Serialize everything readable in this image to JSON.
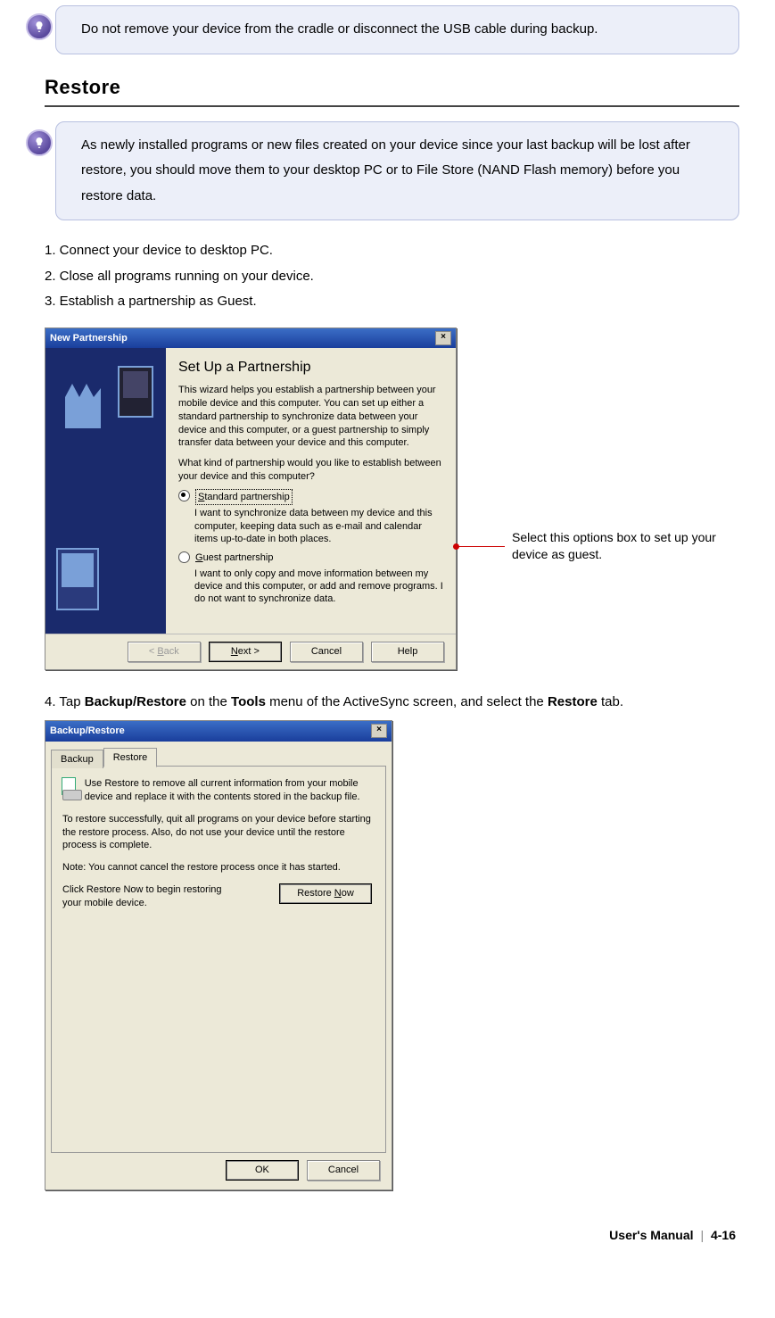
{
  "note1": {
    "text": "Do not remove your device from the cradle or disconnect the USB cable during backup."
  },
  "section_heading": "Restore",
  "note2": {
    "text": "As newly installed programs or new files created on your device since your last backup will be lost after restore, you should move them to your desktop PC or to File Store (NAND Flash memory) before you restore data."
  },
  "steps": {
    "s1": "1. Connect your device to desktop PC.",
    "s2": "2. Close all programs running on your device.",
    "s3": "3. Establish a partnership as Guest."
  },
  "callout": "Select this options box to set up your device as guest.",
  "dlg1": {
    "title": "New Partnership",
    "heading": "Set Up a Partnership",
    "intro": "This wizard helps you establish a partnership between your mobile device and this computer. You can set up either a standard partnership to synchronize data between your device and this computer, or a guest partnership to simply transfer data between your device and this computer.",
    "question": "What kind of partnership would you like to establish between your device and this computer?",
    "opt1_pre": "S",
    "opt1_rest": "tandard partnership",
    "opt1_desc": "I want to synchronize data between my device and this computer, keeping data such as e-mail and calendar items up-to-date in both places.",
    "opt2_pre": "G",
    "opt2_rest": "uest partnership",
    "opt2_desc": "I want to only copy and move information between my device and this computer, or add and remove programs. I do not want to synchronize data.",
    "btn_back_pre": "< ",
    "btn_back_u": "B",
    "btn_back_rest": "ack",
    "btn_next_u": "N",
    "btn_next_rest": "ext >",
    "btn_cancel": "Cancel",
    "btn_help": "Help"
  },
  "step4": {
    "pre": "4. Tap ",
    "b1": "Backup/Restore",
    "mid1": " on the ",
    "b2": "Tools",
    "mid2": " menu of the ActiveSync screen, and select the ",
    "b3": "Restore",
    "post": " tab."
  },
  "dlg2": {
    "title": "Backup/Restore",
    "tab_backup": "Backup",
    "tab_restore": "Restore",
    "p1": "Use Restore to remove all current information from your mobile device and replace it with the contents stored in the backup file.",
    "p2": "To restore successfully, quit all programs on your device before starting the restore process. Also, do not use your device until the restore process is complete.",
    "p3": "Note: You cannot cancel the restore process once it has started.",
    "p4": "Click Restore Now to begin restoring your mobile device.",
    "btn_restore_pre": "Restore ",
    "btn_restore_u": "N",
    "btn_restore_post": "ow",
    "btn_ok": "OK",
    "btn_cancel": "Cancel"
  },
  "footer": {
    "manual": "User's Manual",
    "page": "4-16"
  }
}
